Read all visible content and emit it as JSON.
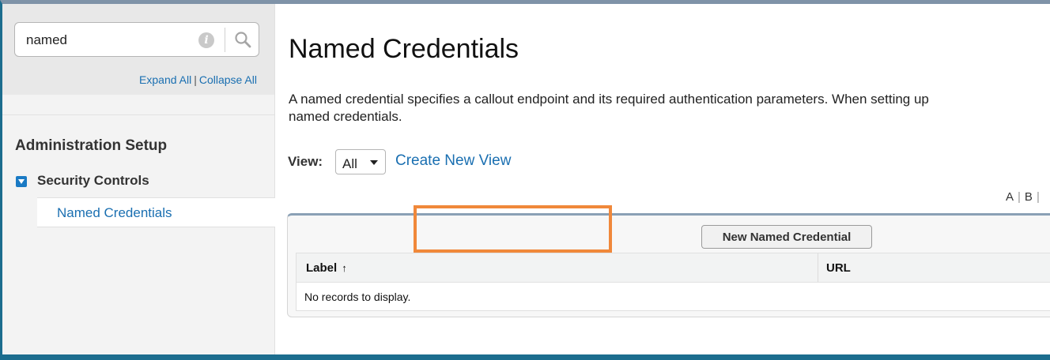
{
  "sidebar": {
    "search_value": "named",
    "info_icon": "info-icon",
    "search_icon": "search-icon",
    "expand_all": "Expand All",
    "separator": "|",
    "collapse_all": "Collapse All",
    "section_heading": "Administration Setup",
    "tree_item": "Security Controls",
    "sub_item": "Named Credentials"
  },
  "main": {
    "title": "Named Credentials",
    "description_line1": "A named credential specifies a callout endpoint and its required authentication parameters. When setting up",
    "description_line2": "named credentials.",
    "view_label": "View:",
    "view_selected": "All",
    "create_view": "Create New View",
    "alpha_a": "A",
    "alpha_b": "B",
    "new_button": "New Named Credential",
    "columns": [
      "Label",
      "URL"
    ],
    "sort_arrow": "↑",
    "empty_message": "No records to display."
  },
  "colors": {
    "accent_link": "#1a6fb1",
    "highlight": "#f0883a",
    "frame": "#1c6d8e"
  }
}
